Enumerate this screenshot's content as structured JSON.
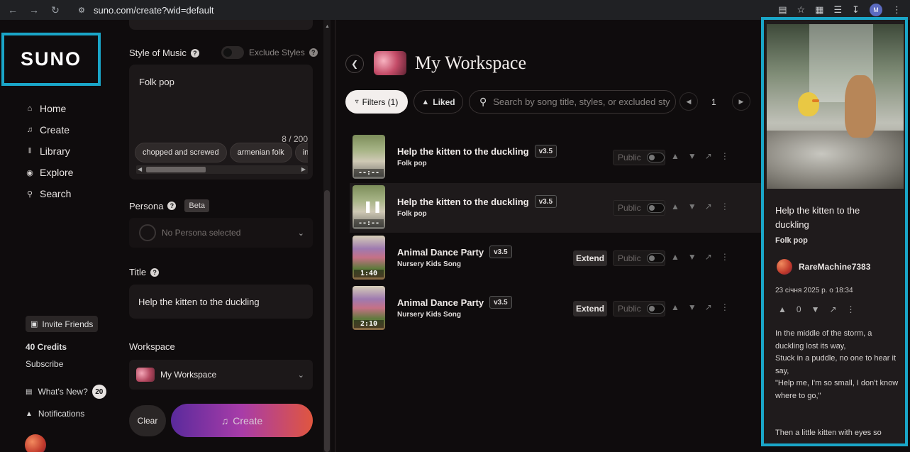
{
  "browser": {
    "url": "suno.com/create?wid=default",
    "profile_initial": "M"
  },
  "sidebar": {
    "logo": "SUNO",
    "nav": [
      {
        "label": "Home",
        "icon": "home-icon"
      },
      {
        "label": "Create",
        "icon": "music-note-icon"
      },
      {
        "label": "Library",
        "icon": "library-icon"
      },
      {
        "label": "Explore",
        "icon": "compass-icon"
      },
      {
        "label": "Search",
        "icon": "search-icon"
      }
    ],
    "invite_label": "Invite Friends",
    "credits": "40 Credits",
    "subscribe": "Subscribe",
    "whats_new": "What's New?",
    "whats_new_count": "20",
    "notifications": "Notifications"
  },
  "create": {
    "style_label": "Style of Music",
    "exclude_label": "Exclude Styles",
    "style_value": "Folk pop",
    "char_count": "8 / 200",
    "chips": [
      "chopped and screwed",
      "armenian folk",
      "insti"
    ],
    "persona_label": "Persona",
    "persona_badge": "Beta",
    "persona_value": "No Persona selected",
    "title_label": "Title",
    "title_value": "Help the kitten to the duckling",
    "workspace_label": "Workspace",
    "workspace_value": "My Workspace",
    "clear_label": "Clear",
    "create_label": "Create"
  },
  "workspace": {
    "title": "My Workspace",
    "filters_label": "Filters (1)",
    "liked_label": "Liked",
    "search_placeholder": "Search by song title, styles, or excluded styles",
    "page": "1",
    "public_label": "Public",
    "extend_label": "Extend",
    "songs": [
      {
        "title": "Help the kitten to the duckling",
        "version": "v3.5",
        "style": "Folk pop",
        "duration": "--:--",
        "extend": false
      },
      {
        "title": "Help the kitten to the duckling",
        "version": "v3.5",
        "style": "Folk pop",
        "duration": "--:--",
        "extend": false
      },
      {
        "title": "Animal Dance Party",
        "version": "v3.5",
        "style": "Nursery Kids Song",
        "duration": "1:40",
        "extend": true
      },
      {
        "title": "Animal Dance Party",
        "version": "v3.5",
        "style": "Nursery Kids Song",
        "duration": "2:10",
        "extend": true
      }
    ]
  },
  "detail": {
    "title": "Help the kitten to the duckling",
    "style": "Folk pop",
    "user": "RareMachine7383",
    "date": "23 січня 2025 р. о 18:34",
    "likes": "0",
    "lyrics": "In the middle of the storm, a duckling lost its way,\nStuck in a puddle, no one to hear it say,\n\"Help me, I'm so small, I don't know where to go,\"",
    "lyrics_next": "Then a little kitten with eyes so"
  },
  "colors": {
    "highlight": "#1aa6c8",
    "background": "#0f0c0d",
    "create_gradient_start": "#5a2a9c",
    "create_gradient_end": "#e0563f"
  }
}
